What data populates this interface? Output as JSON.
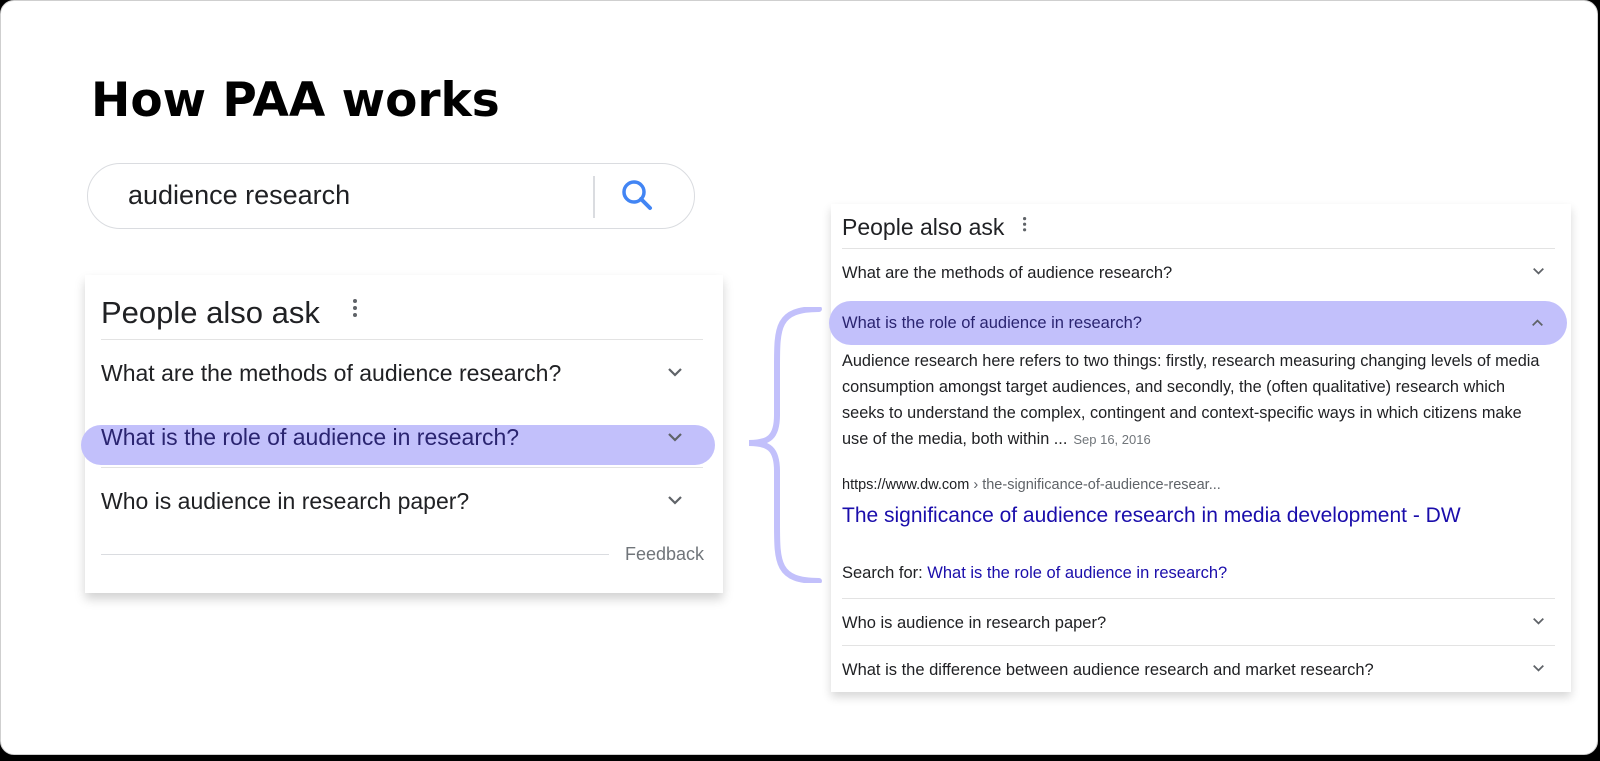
{
  "slide": {
    "title": "How PAA works"
  },
  "search": {
    "query": "audience research",
    "button_icon": "search-icon",
    "accent_color": "#4285f4"
  },
  "paa_left": {
    "heading": "People also ask",
    "questions": [
      {
        "label": "What are the methods of audience research?",
        "highlighted": false
      },
      {
        "label": "What is the role of audience in research?",
        "highlighted": true
      },
      {
        "label": "Who is audience in research paper?",
        "highlighted": false
      }
    ],
    "feedback_label": "Feedback"
  },
  "paa_right": {
    "heading": "People also ask",
    "questions": [
      {
        "label": "What are the methods of audience research?",
        "expanded": false
      },
      {
        "label": "What is the role of audience in research?",
        "expanded": true
      },
      {
        "label": "Who is audience in research paper?",
        "expanded": false
      },
      {
        "label": "What is the difference between audience research and market research?",
        "expanded": false
      }
    ],
    "answer": {
      "text": "Audience research here refers to two things: firstly, research measuring changing levels of media consumption amongst target audiences, and secondly, the (often qualitative) research which seeks to understand the complex, contingent and context-specific ways in which citizens make use of the media, both within ...",
      "date": "Sep 16, 2016",
      "source_domain": "https://www.dw.com",
      "source_path": " › the-significance-of-audience-resear...",
      "source_title": "The significance of audience research in media development - DW",
      "search_for_label": "Search for: ",
      "search_for_link": "What is the role of audience in research?"
    }
  },
  "colors": {
    "highlight": "#c2c0fb",
    "brace": "#c2c0fb",
    "link": "#1a0dab"
  }
}
